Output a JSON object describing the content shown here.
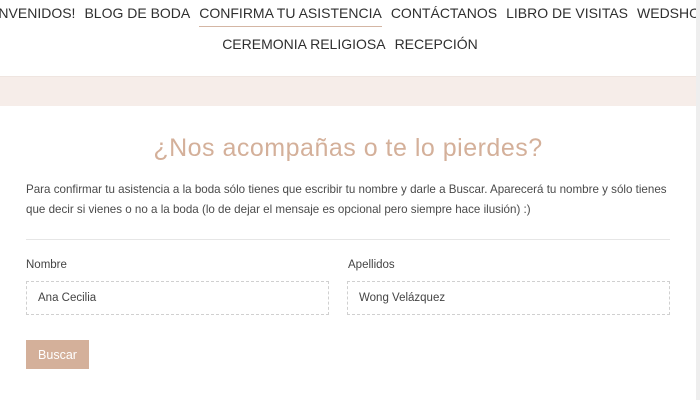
{
  "nav": {
    "row1": [
      "¡BIENVENIDOS!",
      "BLOG DE BODA",
      "CONFIRMA TU ASISTENCIA",
      "CONTÁCTANOS",
      "LIBRO DE VISITAS",
      "WEDSHOOTS"
    ],
    "row2": [
      "CEREMONIA RELIGIOSA",
      "RECEPCIÓN"
    ],
    "active": "CONFIRMA TU ASISTENCIA"
  },
  "main": {
    "title": "¿Nos acompañas o te lo pierdes?",
    "intro": "Para confirmar tu asistencia a la boda sólo tienes que escribir tu nombre y darle a Buscar. Aparecerá tu nombre y sólo tienes que decir si vienes o no a la boda (lo de dejar el mensaje es opcional pero siempre hace ilusión) :)",
    "form": {
      "nombre_label": "Nombre",
      "nombre_value": "Ana Cecilia",
      "apellidos_label": "Apellidos",
      "apellidos_value": "Wong Velázquez",
      "button_label": "Buscar"
    }
  },
  "colors": {
    "accent": "#d4b09a",
    "band": "#f6ede9"
  }
}
